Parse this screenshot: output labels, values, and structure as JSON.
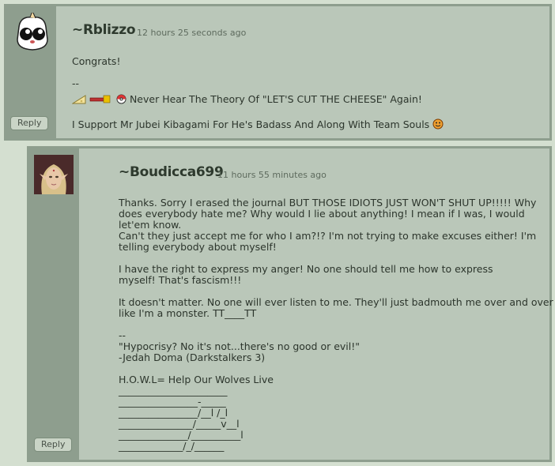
{
  "comments": [
    {
      "username": "~Rblizzo",
      "timestamp": "12 hours 25 seconds ago",
      "message": "Congrats!",
      "signature_sep": "--",
      "signature_line1": "Never Hear The Theory Of \"LET'S CUT THE CHEESE\" Again!",
      "signature_line2": "I Support Mr Jubei Kibagami For He's Badass And Along With Team Souls",
      "reply_label": "Reply"
    },
    {
      "username": "~Boudicca699",
      "timestamp": "11 hours 55 minutes ago",
      "body": "Thanks. Sorry I erased the journal BUT THOSE IDIOTS JUST WON'T SHUT UP!!!!! Why\ndoes everybody hate me? Why would I lie about anything! I mean if I was, I would\nlet'em know.\nCan't they just accept me for who I am?!? I'm not trying to make excuses either! I'm\ntelling everybody about myself!\n\nI have the right to express my anger! No one should tell me how to express\nmyself! That's fascism!!!\n\nIt doesn't matter. No one will ever listen to me. They'll just badmouth me over and over\nlike I'm a monster. TT____TT\n\n--\n\"Hypocrisy? No it's not...there's no good or evil!\"\n-Jedah Doma (Darkstalkers 3)\n\nH.O.W.L= Help Our Wolves Live\n______________________\n________________-_____\n________________/__l /_l\n_______________/_____v__l\n______________/__________l\n_____________/_/______",
      "reply_label": "Reply"
    }
  ],
  "colors": {
    "background": "#d4dfd0",
    "frame": "#8e9e8e",
    "panel": "#bac7b9",
    "text": "#2c352c"
  }
}
